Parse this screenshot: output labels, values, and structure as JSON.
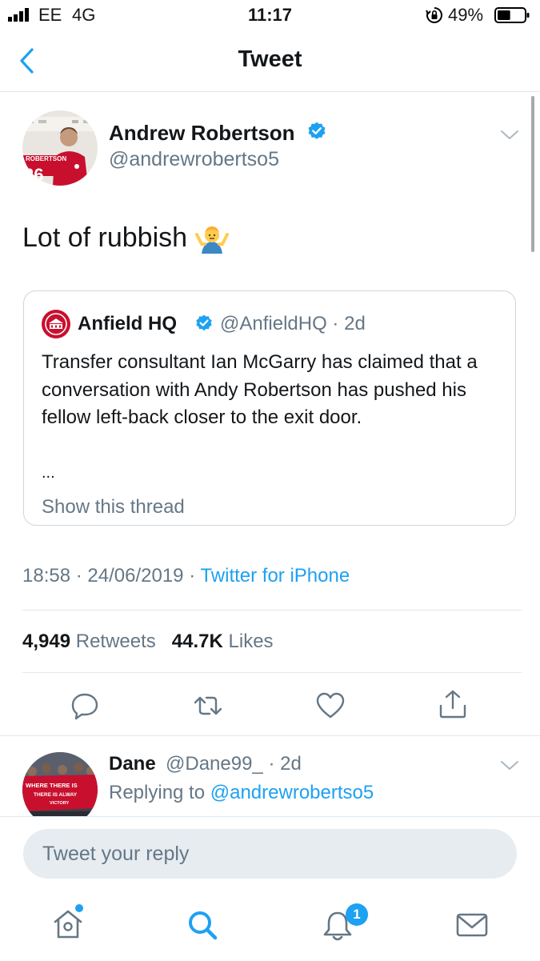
{
  "status_bar": {
    "carrier": "EE",
    "network": "4G",
    "time": "11:17",
    "battery_percent": "49%",
    "battery_level": 0.49
  },
  "nav": {
    "title": "Tweet"
  },
  "tweet": {
    "author_name": "Andrew Robertson",
    "author_handle": "@andrewrobertso5",
    "avatar_text": "ROBERTSON",
    "avatar_number": "26",
    "text": "Lot of rubbish",
    "quoted": {
      "name": "Anfield HQ",
      "handle": "@AnfieldHQ",
      "separator": "·",
      "age": "2d",
      "text": "Transfer consultant Ian McGarry has claimed that a conversation with Andy Robertson has pushed his fellow left-back closer to the exit door.",
      "ellipsis": "...",
      "show_thread": "Show this thread"
    },
    "time": "18:58",
    "date": "24/06/2019",
    "separator": "·",
    "source": "Twitter for iPhone",
    "retweet_count": "4,949",
    "retweet_label": "Retweets",
    "like_count": "44.7K",
    "like_label": "Likes"
  },
  "reply": {
    "name": "Dane",
    "handle": "@Dane99_",
    "separator": "·",
    "age": "2d",
    "replying_label": "Replying to",
    "replying_handle": "@andrewrobertso5",
    "avatar_banner_1": "WHERE THERE IS",
    "avatar_banner_2": "THERE IS ALWAY",
    "avatar_banner_3": "VICTORY"
  },
  "composer": {
    "placeholder": "Tweet your reply"
  },
  "tab_bar": {
    "notification_badge": "1"
  },
  "colors": {
    "accent": "#1da1f2",
    "text": "#14171a",
    "secondary": "#657786",
    "divider": "#e1e8ed"
  }
}
